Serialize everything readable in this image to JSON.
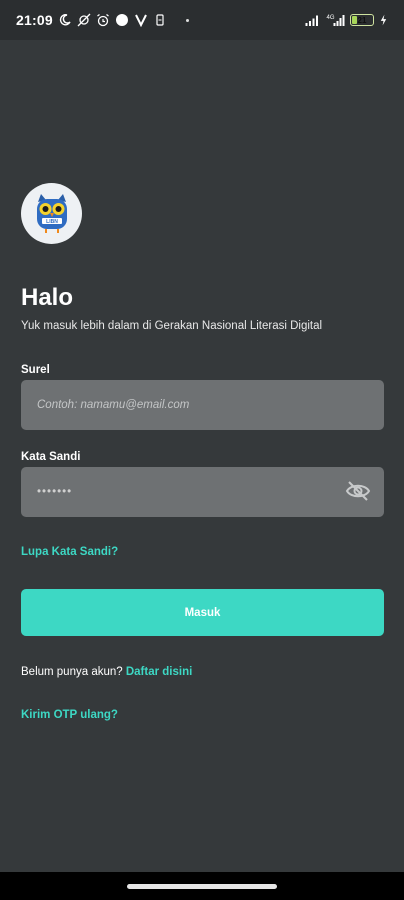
{
  "status_bar": {
    "time": "21:09",
    "icons_left": [
      "moon-icon",
      "no-notifications-icon",
      "alarm-icon",
      "circle-icon",
      "v-app-icon",
      "storage-icon"
    ],
    "icons_right": [
      "signal-icon",
      "4g-icon",
      "signal-icon",
      "battery-icon",
      "charging-icon"
    ],
    "battery_level": "21"
  },
  "logo": {
    "icon": "owl-logo-icon",
    "text": "LIBN"
  },
  "header": {
    "title": "Halo",
    "subtitle": "Yuk masuk lebih dalam di Gerakan Nasional Literasi Digital"
  },
  "form": {
    "email": {
      "label": "Surel",
      "placeholder": "Contoh: namamu@email.com",
      "value": ""
    },
    "password": {
      "label": "Kata Sandi",
      "value": "•••••••",
      "toggle_icon": "eye-off-icon"
    }
  },
  "links": {
    "forgot_password": "Lupa Kata Sandi?",
    "resend_otp": "Kirim OTP ulang?"
  },
  "buttons": {
    "login": "Masuk"
  },
  "register": {
    "prompt": "Belum punya akun?",
    "link": "Daftar disini"
  },
  "colors": {
    "background": "#35393b",
    "accent": "#3dd8c4",
    "input_bg": "#6e7173",
    "status_bar_bg": "#2b2e30"
  }
}
